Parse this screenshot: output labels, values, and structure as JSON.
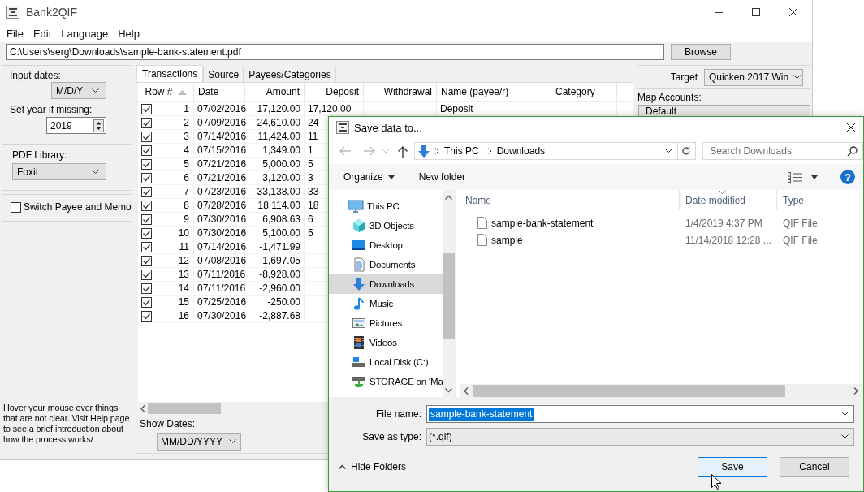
{
  "window": {
    "title": "Bank2QIF"
  },
  "menu": [
    "File",
    "Edit",
    "Language",
    "Help"
  ],
  "file_path": {
    "value": "C:\\Users\\serg\\Downloads\\sample-bank-statement.pdf"
  },
  "browse_button": "Browse",
  "left_panel": {
    "input_dates_label": "Input dates:",
    "input_dates_value": "M/D/Y",
    "year_label": "Set year if missing:",
    "year_value": "2019",
    "pdf_library_label": "PDF Library:",
    "pdf_library_value": "Foxit",
    "switch_payee": {
      "label": "Switch Payee and Memo",
      "checked": false
    },
    "hint": "Hover your mouse over things that are not clear. Visit Help page to see a brief introduction about how the process works/"
  },
  "tabs": [
    {
      "label": "Transactions",
      "selected": true
    },
    {
      "label": "Source",
      "selected": false
    },
    {
      "label": "Payees/Categories",
      "selected": false
    }
  ],
  "table": {
    "columns": [
      {
        "label": "Row #",
        "sorted": true
      },
      {
        "label": "Date",
        "sorted": false
      },
      {
        "label": "Amount",
        "sorted": false
      },
      {
        "label": "Deposit",
        "sorted": false
      },
      {
        "label": "Withdrawal",
        "sorted": false
      },
      {
        "label": "Name (payee/r)",
        "sorted": false
      },
      {
        "label": "Category",
        "sorted": false
      }
    ],
    "rows": [
      {
        "checked": true,
        "row": "1",
        "date": "07/02/2016",
        "amount": "17,120.00",
        "deposit": "17,120.00",
        "name": "Deposit"
      },
      {
        "checked": true,
        "row": "2",
        "date": "07/09/2016",
        "amount": "24,610.00",
        "deposit": "24"
      },
      {
        "checked": true,
        "row": "3",
        "date": "07/14/2016",
        "amount": "11,424.00",
        "deposit": "11"
      },
      {
        "checked": true,
        "row": "4",
        "date": "07/15/2016",
        "amount": "1,349.00",
        "deposit": "1"
      },
      {
        "checked": true,
        "row": "5",
        "date": "07/21/2016",
        "amount": "5,000.00",
        "deposit": "5"
      },
      {
        "checked": true,
        "row": "6",
        "date": "07/21/2016",
        "amount": "3,120.00",
        "deposit": "3"
      },
      {
        "checked": true,
        "row": "7",
        "date": "07/23/2016",
        "amount": "33,138.00",
        "deposit": "33"
      },
      {
        "checked": true,
        "row": "8",
        "date": "07/28/2016",
        "amount": "18,114.00",
        "deposit": "18"
      },
      {
        "checked": true,
        "row": "9",
        "date": "07/30/2016",
        "amount": "6,908.63",
        "deposit": "6"
      },
      {
        "checked": true,
        "row": "10",
        "date": "07/30/2016",
        "amount": "5,100.00",
        "deposit": "5"
      },
      {
        "checked": true,
        "row": "11",
        "date": "07/14/2016",
        "amount": "-1,471.99"
      },
      {
        "checked": true,
        "row": "12",
        "date": "07/08/2016",
        "amount": "-1,697.05"
      },
      {
        "checked": true,
        "row": "13",
        "date": "07/11/2016",
        "amount": "-8,928.00"
      },
      {
        "checked": true,
        "row": "14",
        "date": "07/11/2016",
        "amount": "-2,960.00"
      },
      {
        "checked": true,
        "row": "15",
        "date": "07/25/2016",
        "amount": "-250.00"
      },
      {
        "checked": true,
        "row": "16",
        "date": "07/30/2016",
        "amount": "-2,887.68"
      }
    ]
  },
  "show_dates": {
    "label": "Show Dates:",
    "value": "MM/DD/YYYY"
  },
  "target": {
    "label": "Target",
    "value": "Quicken 2017 Win"
  },
  "map_accounts": {
    "label": "Map Accounts:",
    "items": [
      "Default"
    ]
  },
  "dialog": {
    "title": "Save data to...",
    "breadcrumbs": [
      "This PC",
      "Downloads"
    ],
    "search": {
      "placeholder": "Search Downloads"
    },
    "toolbar": {
      "organize": "Organize",
      "new_folder": "New folder",
      "help_button": "?"
    },
    "nav_tree": [
      {
        "label": "This PC",
        "selected": false,
        "children": [
          {
            "label": "3D Objects",
            "selected": false
          },
          {
            "label": "Desktop",
            "selected": false
          },
          {
            "label": "Documents",
            "selected": false
          },
          {
            "label": "Downloads",
            "selected": true
          },
          {
            "label": "Music",
            "selected": false
          },
          {
            "label": "Pictures",
            "selected": false
          },
          {
            "label": "Videos",
            "selected": false
          },
          {
            "label": "Local Disk (C:)",
            "selected": false
          },
          {
            "label": "STORAGE on 'Ma",
            "selected": false
          }
        ]
      }
    ],
    "file_columns": [
      {
        "label": "Name",
        "sorted": false
      },
      {
        "label": "Date modified",
        "sorted": true
      },
      {
        "label": "Type",
        "sorted": false
      }
    ],
    "files": [
      {
        "name": "sample-bank-statement",
        "date": "1/4/2019 4:37 PM",
        "type": "QIF File"
      },
      {
        "name": "sample",
        "date": "11/14/2018 12:28 ...",
        "type": "QIF File"
      }
    ],
    "file_name": {
      "label": "File name:",
      "value": "sample-bank-statement",
      "highlighted": true
    },
    "save_type": {
      "label": "Save as type:",
      "value": "(*.qif)"
    },
    "hide_folders": "Hide Folders",
    "buttons": [
      {
        "label": "Save",
        "default": true
      },
      {
        "label": "Cancel",
        "default": false
      }
    ]
  }
}
